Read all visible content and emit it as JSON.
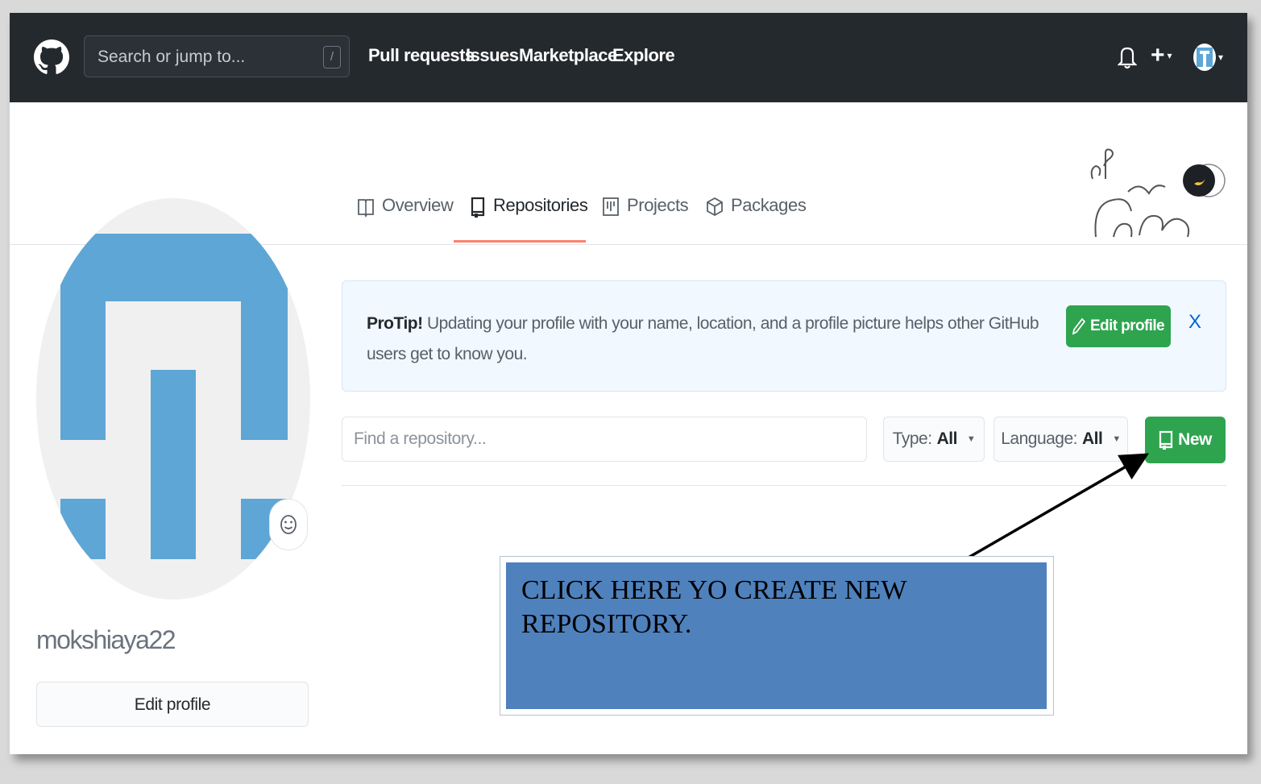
{
  "header": {
    "search_placeholder": "Search or jump to...",
    "slash_key": "/",
    "nav": [
      "Pull requests",
      "Issues",
      "Marketplace",
      "Explore"
    ],
    "plus_caret": "▾",
    "avatar_caret": "▾"
  },
  "tabs": [
    {
      "label": "Overview",
      "active": false
    },
    {
      "label": "Repositories",
      "active": true
    },
    {
      "label": "Projects",
      "active": false
    },
    {
      "label": "Packages",
      "active": false
    }
  ],
  "profile": {
    "username": "mokshiaya22",
    "edit_profile_label": "Edit profile"
  },
  "protip": {
    "lead": "ProTip!",
    "text": "Updating your profile with your name, location, and a profile picture helps other GitHub users get to know you.",
    "edit_profile_label": "Edit profile",
    "close": "X"
  },
  "repo_filter": {
    "find_placeholder": "Find a repository...",
    "type_label": "Type:",
    "type_value": "All",
    "language_label": "Language:",
    "language_value": "All",
    "new_label": "New"
  },
  "callout": {
    "text": "CLICK HERE YO CREATE NEW REPOSITORY."
  },
  "colors": {
    "header_bg": "#24292e",
    "accent_green": "#2ea44f",
    "tab_underline": "#f9826c",
    "avatar_blue": "#5ea6d6",
    "callout_blue": "#4f81bd",
    "protip_bg": "#f1f8ff"
  }
}
